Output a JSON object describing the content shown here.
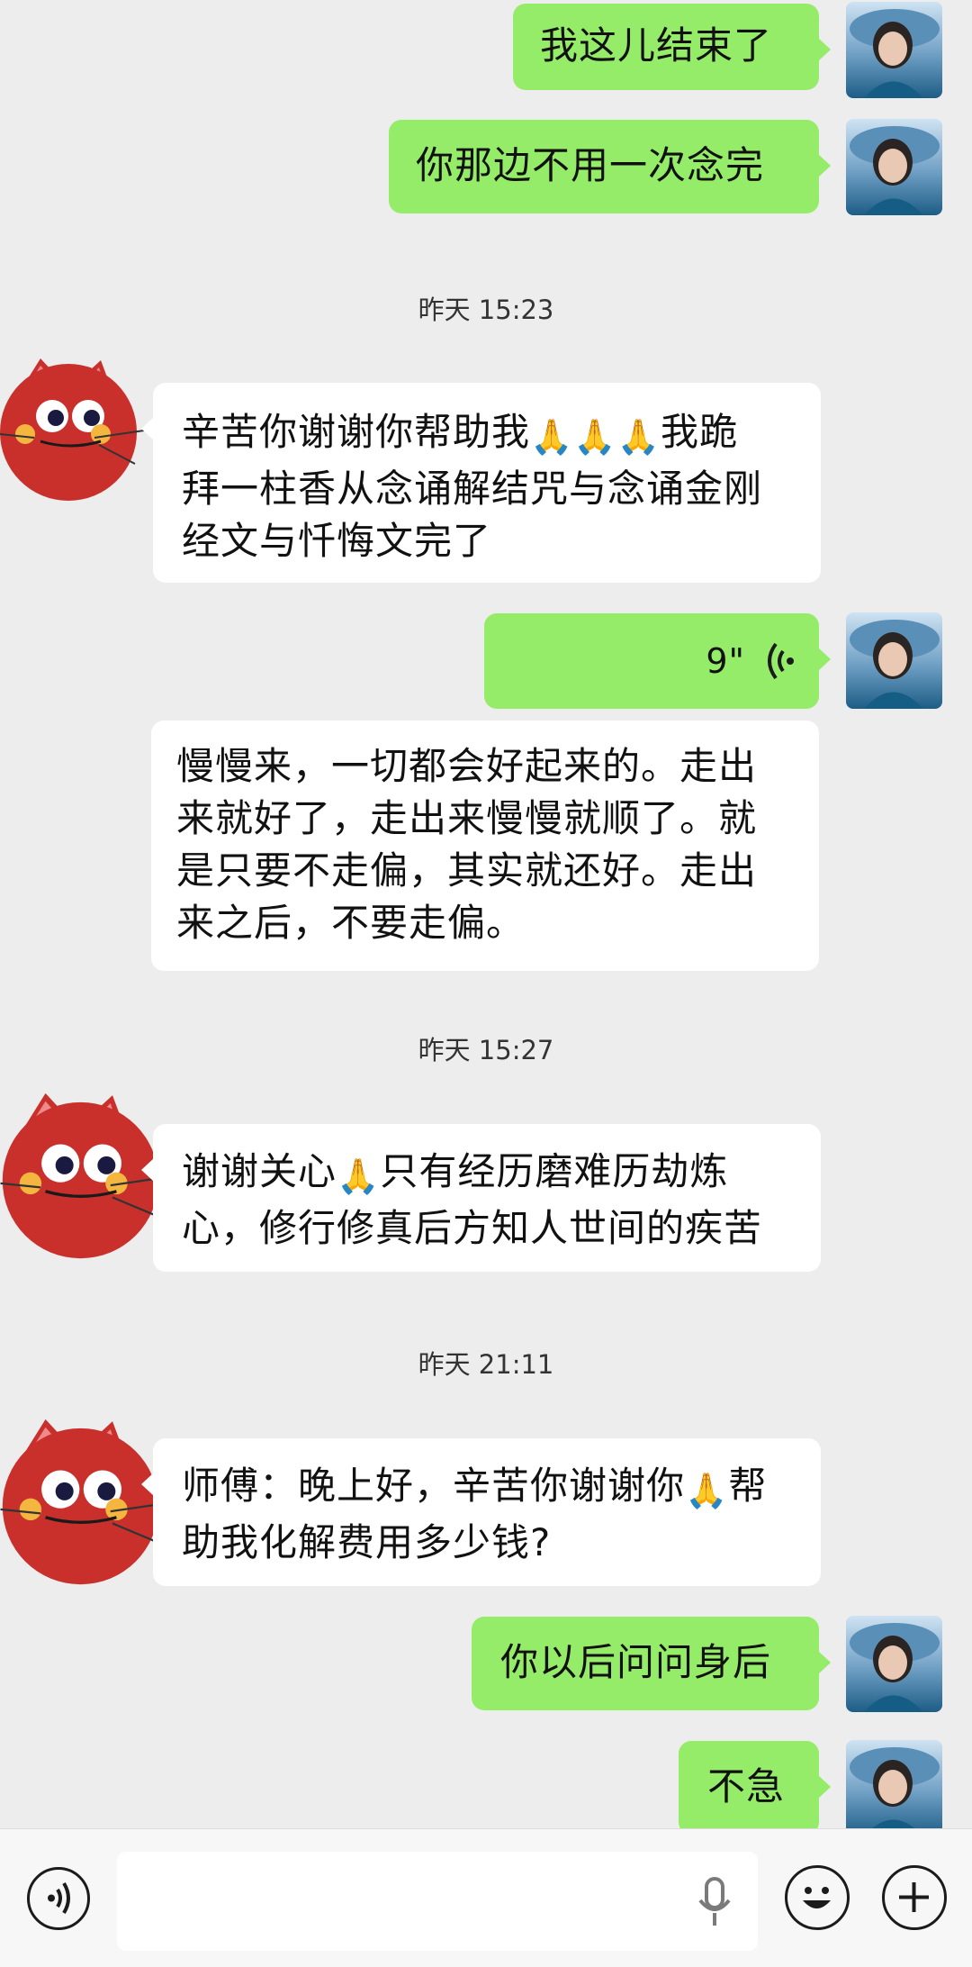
{
  "messages": {
    "m1": {
      "text": "我这儿结束了"
    },
    "m2": {
      "text": "你那边不用一次念完"
    },
    "t1": "昨天 15:23",
    "m3": {
      "line1a": "辛苦你谢谢你帮助我",
      "pray": "🙏🙏🙏",
      "line1b": "我跪",
      "line2": "拜一柱香从念诵解结咒与念诵金刚",
      "line3": "经文与忏悔文完了"
    },
    "m4": {
      "duration": "9\""
    },
    "m5": {
      "line1": "慢慢来，一切都会好起来的。走出",
      "line2": "来就好了，走出来慢慢就顺了。就",
      "line3": "是只要不走偏，其实就还好。走出",
      "line4": "来之后，不要走偏。"
    },
    "t2": "昨天 15:27",
    "m6": {
      "line1a": "谢谢关心",
      "pray": "🙏",
      "line1b": "只有经历磨难历劫炼",
      "line2": "心，修行修真后方知人世间的疾苦"
    },
    "t3": "昨天 21:11",
    "m7": {
      "line1a": "师傅：晚上好，辛苦你谢谢你",
      "pray": "🙏",
      "line1b": "帮",
      "line2": "助我化解费用多少钱?"
    },
    "m8": {
      "text": "你以后问问身后"
    },
    "m9": {
      "text": "不急"
    }
  },
  "icons": {
    "voice": "voice-mode-icon",
    "mic": "microphone-icon",
    "emoji": "emoji-icon",
    "plus": "plus-icon"
  },
  "colors": {
    "out_bubble": "#95ec69",
    "in_bubble": "#ffffff",
    "background": "#ededed"
  }
}
